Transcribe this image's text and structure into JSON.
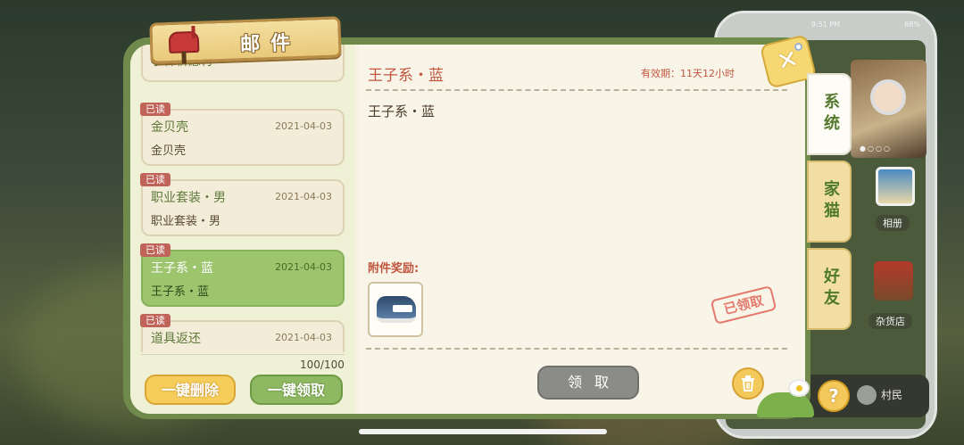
{
  "window": {
    "title": "邮件"
  },
  "mail_list": {
    "items": [
      {
        "read_tag": "",
        "title": "小森祈愿符",
        "date": "",
        "subtitle": ""
      },
      {
        "read_tag": "已读",
        "title": "金贝壳",
        "date": "2021-04-03",
        "subtitle": "金贝壳"
      },
      {
        "read_tag": "已读",
        "title": "职业套装・男",
        "date": "2021-04-03",
        "subtitle": "职业套装・男"
      },
      {
        "read_tag": "已读",
        "title": "王子系・蓝",
        "date": "2021-04-03",
        "subtitle": "王子系・蓝",
        "selected": true
      },
      {
        "read_tag": "已读",
        "title": "道具返还",
        "date": "2021-04-03",
        "subtitle": ""
      }
    ],
    "count": "100/100",
    "delete_all_label": "一键删除",
    "claim_all_label": "一键领取"
  },
  "detail": {
    "title": "王子系・蓝",
    "validity": "有效期：11天12小时",
    "body": "王子系・蓝",
    "attachment_label": "附件奖励:",
    "attachment_icon": "sneaker-icon",
    "claimed_stamp": "已领取",
    "claim_label": "领取"
  },
  "tabs": [
    {
      "label": "系统",
      "active": true
    },
    {
      "label": "家猫",
      "active": false
    },
    {
      "label": "好友",
      "active": false
    }
  ],
  "phone": {
    "apps": [
      {
        "label": "相册"
      },
      {
        "label": "杂货店"
      }
    ],
    "bottom_label": "村民"
  },
  "help_label": "?",
  "colors": {
    "panel_green": "#6f8a4a",
    "selected_card": "#9dc56e",
    "accent_red": "#c1563f",
    "button_yellow": "#f6cd5a",
    "button_green": "#8fb863"
  }
}
